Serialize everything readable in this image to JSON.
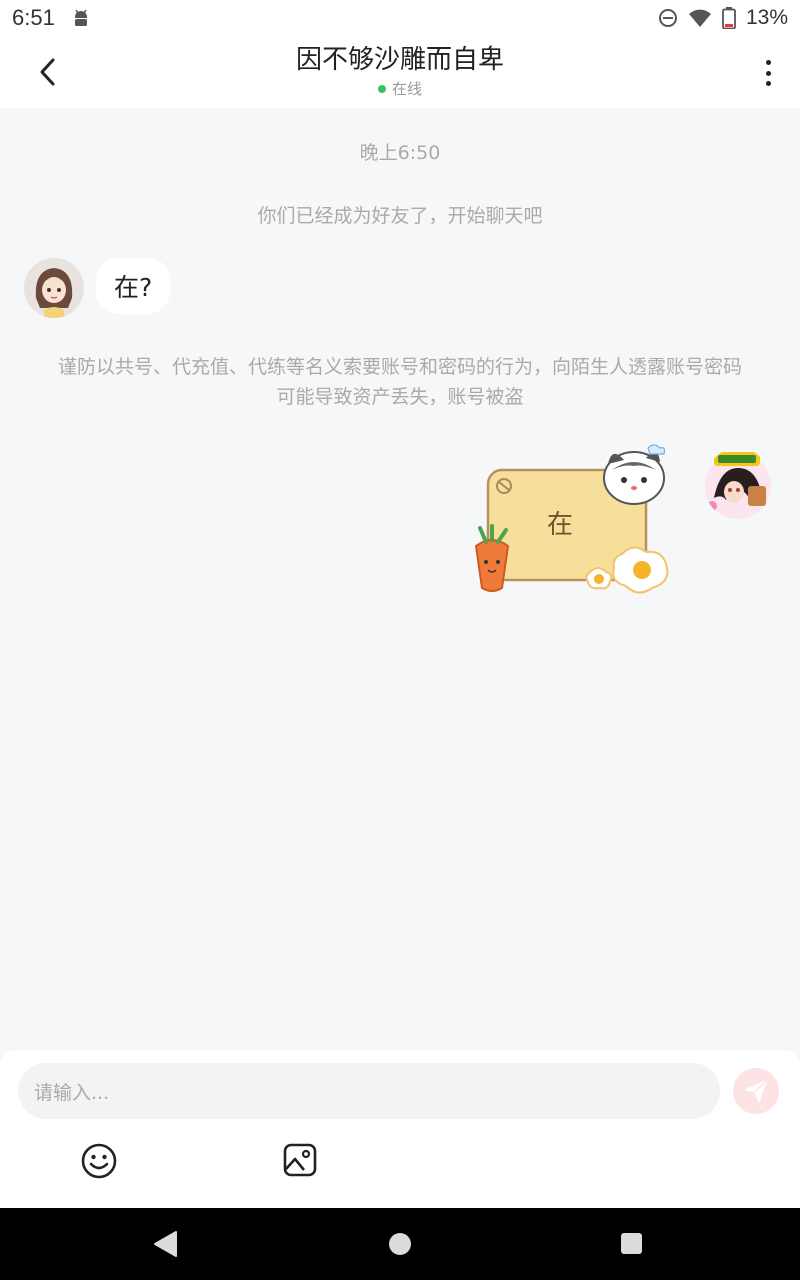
{
  "status_bar": {
    "time": "6:51",
    "battery": "13%",
    "icons": [
      "android-icon",
      "do-not-disturb-icon",
      "wifi-icon",
      "battery-icon"
    ]
  },
  "header": {
    "title": "因不够沙雕而自卑",
    "status": "在线",
    "status_color": "#3ac55b",
    "back_icon": "chevron-left-icon",
    "more_icon": "more-vertical-icon"
  },
  "chat": {
    "time_label": "晚上6:50",
    "system_friend": "你们已经成为好友了，开始聊天吧",
    "messages": [
      {
        "side": "left",
        "text": "在?"
      }
    ],
    "warning": "谨防以共号、代充值、代练等名义索要账号和密码的行为，向陌生人透露账号密码可能导致资产丢失，账号被盗",
    "sticker_text": "在"
  },
  "composer": {
    "placeholder": "请输入...",
    "send_icon": "send-icon",
    "emoji_icon": "emoji-icon",
    "image_icon": "image-icon",
    "accent": "#f19a9a"
  },
  "nav": {
    "icons": [
      "back-triangle-icon",
      "home-circle-icon",
      "recents-square-icon"
    ]
  }
}
